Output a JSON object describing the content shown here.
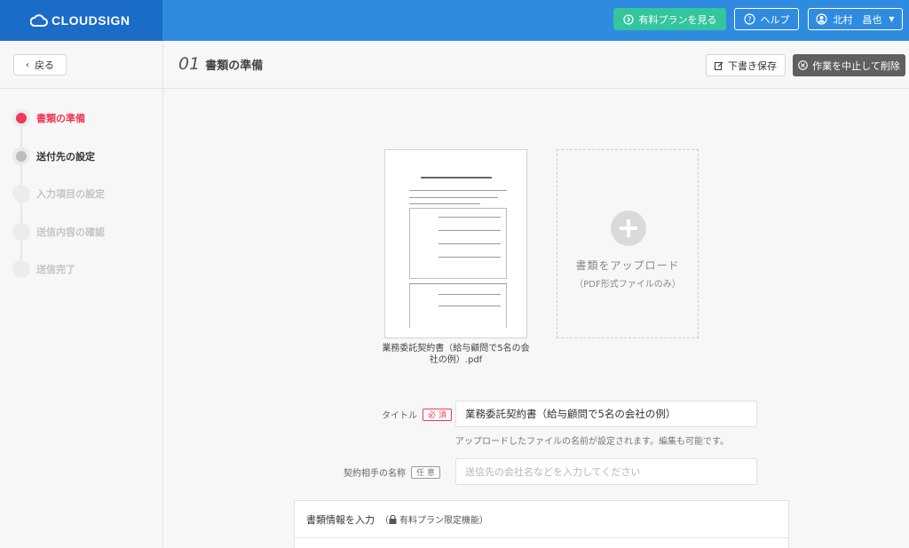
{
  "header": {
    "logo_text": "CLOUDSIGN",
    "plan_button": "有料プランを見る",
    "help_button": "ヘルプ",
    "user_name": "北村　昌也"
  },
  "subheader": {
    "back_label": "戻る",
    "step_number": "01",
    "step_title": "書類の準備",
    "draft_label": "下書き保存",
    "cancel_label": "作業を中止して削除"
  },
  "steps": [
    {
      "label": "書類の準備",
      "state": "active"
    },
    {
      "label": "送付先の設定",
      "state": "next"
    },
    {
      "label": "入力項目の設定",
      "state": "todo"
    },
    {
      "label": "送信内容の確認",
      "state": "todo"
    },
    {
      "label": "送信完了",
      "state": "todo"
    }
  ],
  "document": {
    "file_name": "業務委託契約書（給与顧問で5名の会社の例）.pdf"
  },
  "upload": {
    "title": "書類をアップロード",
    "subtitle": "（PDF形式ファイルのみ）"
  },
  "form": {
    "title_label": "タイトル",
    "required_tag": "必 須",
    "title_value": "業務委託契約書（給与顧問で5名の会社の例）",
    "title_help": "アップロードしたファイルの名前が設定されます。編集も可能です。",
    "partner_label": "契約相手の名称",
    "optional_tag": "任 意",
    "partner_placeholder": "送信先の会社名などを入力してください"
  },
  "info_panel": {
    "heading": "書類情報を入力",
    "paid_note": "有料プラン限定機能"
  },
  "colors": {
    "header_blue": "#2f8be0",
    "logo_blue": "#1a6cc7",
    "plan_green": "#33c59d",
    "accent_red": "#f0385a",
    "cancel_gray": "#5f5f5f"
  }
}
